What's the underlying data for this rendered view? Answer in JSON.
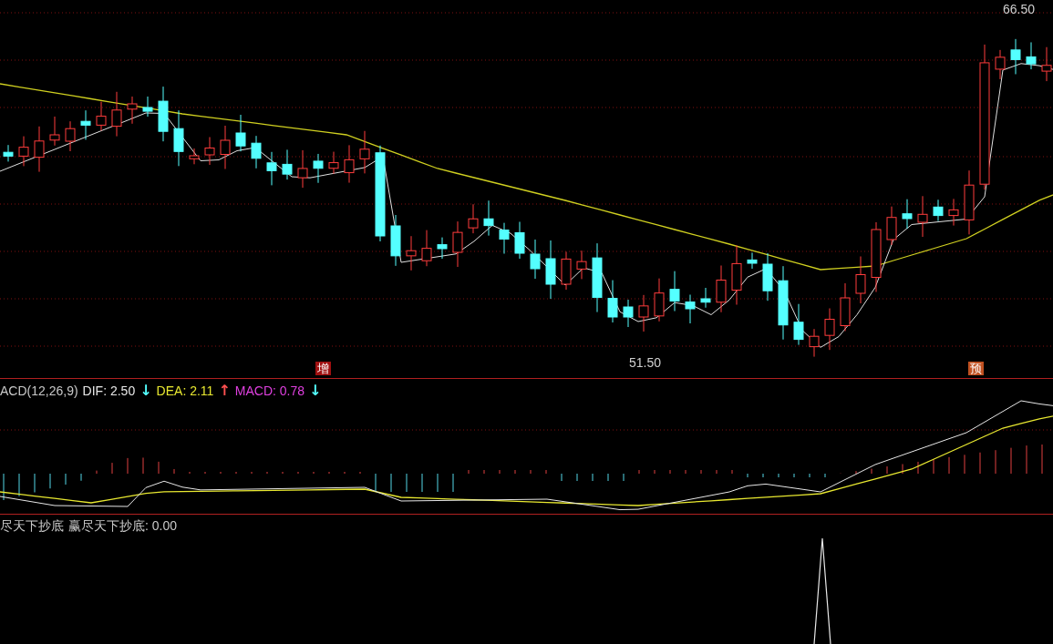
{
  "price_panel": {
    "high_label": "66.50",
    "low_label": "51.50",
    "markers": [
      {
        "text": "增"
      },
      {
        "text": "预"
      }
    ]
  },
  "macd_panel": {
    "legend": [
      {
        "text": "ACD(12,26,9)",
        "color": "#c8c8c8"
      },
      {
        "text": "DIF: 2.50",
        "color": "#e8e8e8"
      },
      {
        "text": "↓",
        "color": "#54ffff"
      },
      {
        "text": "DEA: 2.11",
        "color": "#e8e830"
      },
      {
        "text": "↑",
        "color": "#ff5050"
      },
      {
        "text": "MACD: 0.78",
        "color": "#e040e0"
      },
      {
        "text": "↓",
        "color": "#54ffff"
      }
    ]
  },
  "indicator_panel": {
    "legend": [
      {
        "text": "尽天下抄底",
        "color": "#c8c8c8"
      },
      {
        "text": "赢尽天下抄底: 0.00",
        "color": "#c8c8c8"
      }
    ]
  }
}
